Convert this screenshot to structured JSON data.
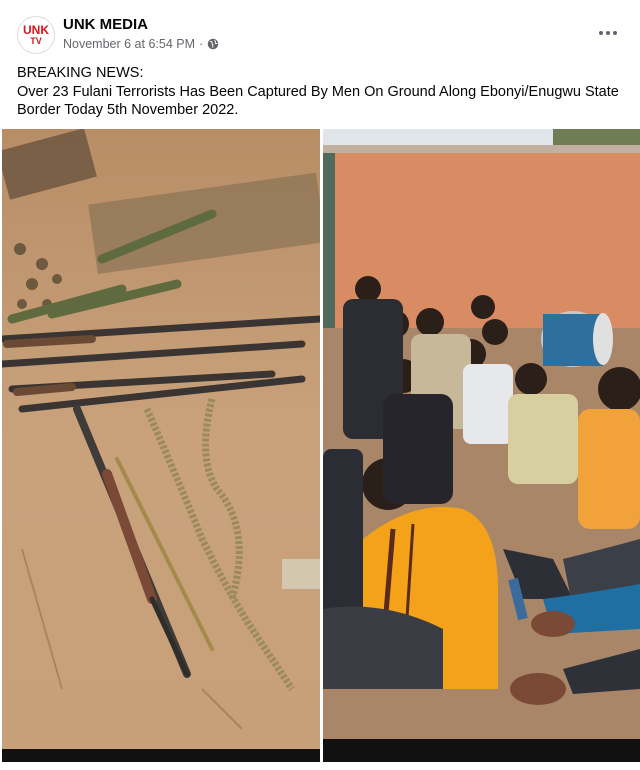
{
  "post": {
    "page_name": "UNK MEDIA",
    "avatar_logo": {
      "line1": "UNK",
      "line2": "TV"
    },
    "timestamp": "November 6 at 6:54 PM",
    "separator": "·",
    "audience_icon": "globe-icon",
    "more_icon": "more-options-icon",
    "text_line1": "BREAKING NEWS:",
    "text_line2": "Over 23 Fulani Terrorists Has Been Captured By Men On Ground Along Ebonyi/Enugwu State Border Today 5th November 2022."
  },
  "photos": [
    {
      "description_icon": "recovered-weapons-photo"
    },
    {
      "description_icon": "seated-suspects-photo"
    }
  ],
  "colors": {
    "text_primary": "#050505",
    "text_secondary": "#65676b",
    "brand_red": "#d6161d",
    "wall_orange": "#d98c63"
  }
}
